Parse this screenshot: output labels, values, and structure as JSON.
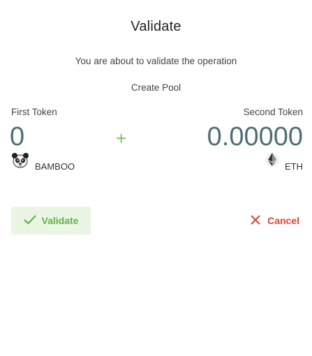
{
  "dialog": {
    "title": "Validate",
    "message": "You are about to validate the operation",
    "operation": "Create Pool"
  },
  "first_token": {
    "label": "First Token",
    "amount": "0",
    "symbol": "BAMBOO",
    "icon": "panda-icon"
  },
  "second_token": {
    "label": "Second Token",
    "amount": "0.00000",
    "symbol": "ETH",
    "icon": "ethereum-icon"
  },
  "separator": "+",
  "actions": {
    "validate_label": "Validate",
    "cancel_label": "Cancel"
  },
  "colors": {
    "accent_green": "#5fb447",
    "validate_bg": "#eaf6e3",
    "cancel_red": "#e2432c",
    "amount_color": "#4f6f73"
  }
}
